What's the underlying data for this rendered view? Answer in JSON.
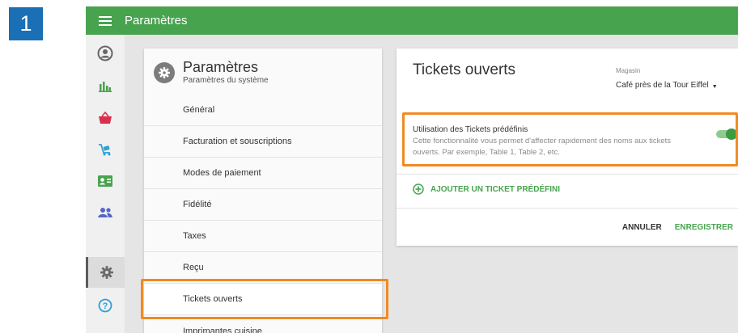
{
  "step_badge": "1",
  "app": {
    "title": "Paramètres"
  },
  "rail": {
    "items": [
      {
        "icon": "account-icon",
        "active": false
      },
      {
        "icon": "reports-chart-icon",
        "active": false
      },
      {
        "icon": "basket-icon",
        "active": false
      },
      {
        "icon": "items-cart-icon",
        "active": false
      },
      {
        "icon": "customers-card-icon",
        "active": false
      },
      {
        "icon": "employees-icon",
        "active": false
      },
      {
        "icon": "settings-gear-icon",
        "active": true
      },
      {
        "icon": "help-icon",
        "active": false
      }
    ]
  },
  "settings": {
    "title": "Paramètres",
    "subtitle": "Paramètres du système",
    "nav": [
      {
        "label": "Général"
      },
      {
        "label": "Facturation et souscriptions"
      },
      {
        "label": "Modes de paiement"
      },
      {
        "label": "Fidélité"
      },
      {
        "label": "Taxes"
      },
      {
        "label": "Reçu"
      },
      {
        "label": "Tickets ouverts"
      },
      {
        "label": "Imprimantes cuisine"
      }
    ],
    "selected_index": 6
  },
  "open_tickets": {
    "title": "Tickets ouverts",
    "store_label": "Magasin",
    "store_value": "Café près de la Tour Eiffel",
    "option_title": "Utilisation des Tickets prédéfinis",
    "option_desc": "Cette fonctionnalité vous permet d'affecter rapidement des noms aux tickets ouverts. Par exemple, Table 1, Table 2, etc.",
    "option_enabled": true,
    "add_label": "AJOUTER UN TICKET PRÉDÉFINI",
    "cancel_label": "ANNULER",
    "save_label": "ENREGISTRER"
  },
  "colors": {
    "brand_green": "#48a34f",
    "highlight_orange": "#f08a24",
    "step_blue": "#1a6fb5"
  }
}
